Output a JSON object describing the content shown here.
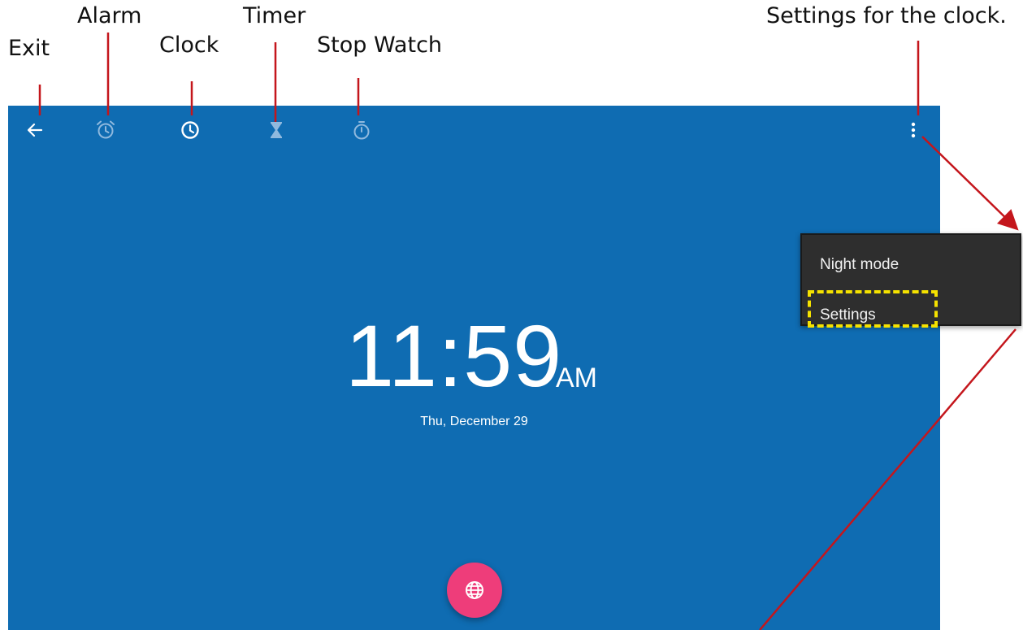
{
  "annotations": {
    "exit": "Exit",
    "alarm": "Alarm",
    "clock": "Clock",
    "timer": "Timer",
    "stopwatch": "Stop Watch",
    "settings_clock": "Settings for the clock."
  },
  "toolbar": {
    "back_icon": "arrow-left-icon",
    "alarm_icon": "alarm-icon",
    "clock_icon": "clock-icon",
    "timer_icon": "hourglass-icon",
    "stopwatch_icon": "stopwatch-icon",
    "more_icon": "more-vert-icon"
  },
  "clock": {
    "time": "11:59",
    "ampm": "AM",
    "date": "Thu, December 29"
  },
  "fab": {
    "icon": "globe-icon"
  },
  "menu": {
    "items": [
      {
        "label": "Night mode"
      },
      {
        "label": "Settings"
      }
    ]
  },
  "colors": {
    "app_background": "#0f6cb2",
    "fab": "#ee3d7a",
    "menu_background": "#2e2e2e",
    "highlight": "#f5e200",
    "annotation_line": "#c4161c"
  }
}
